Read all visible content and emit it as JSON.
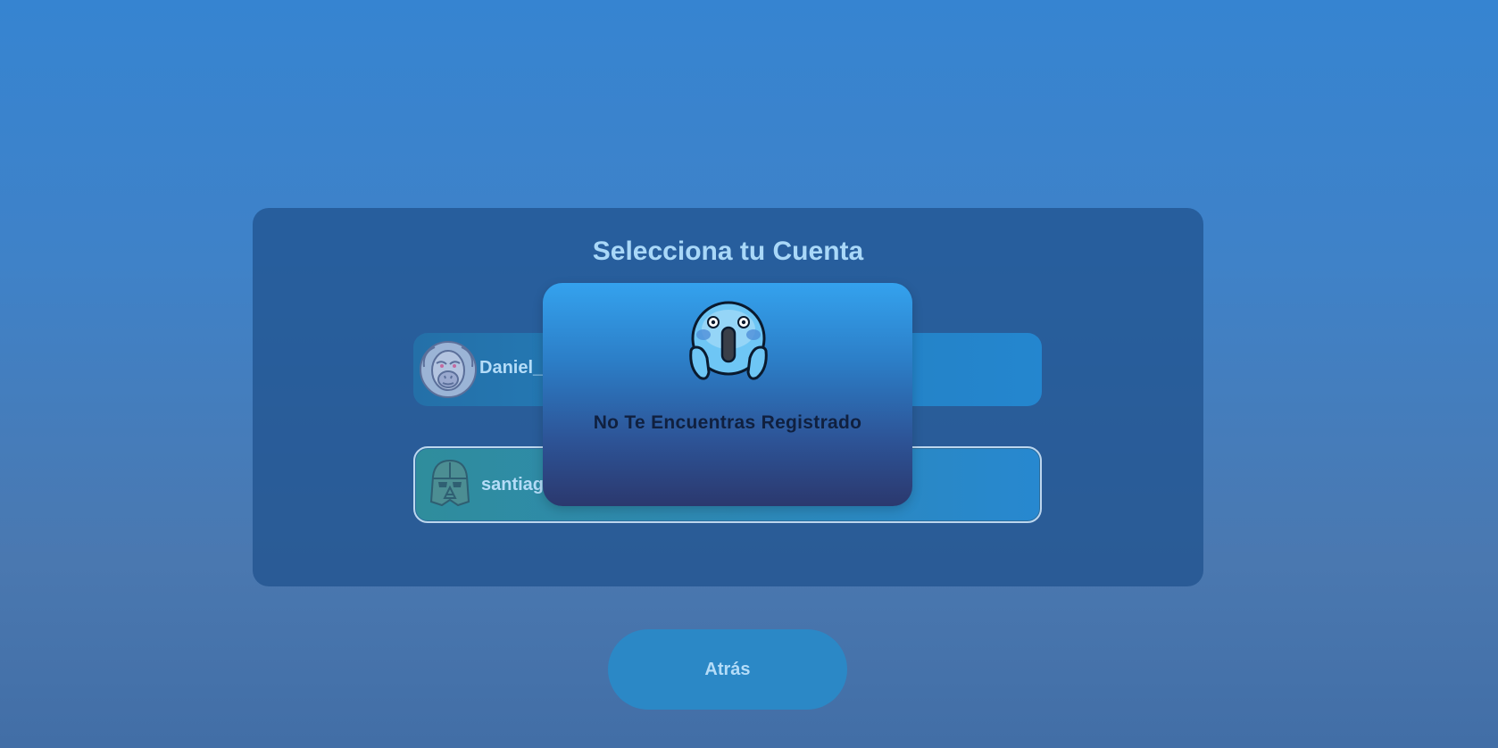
{
  "panel": {
    "title": "Selecciona tu Cuenta",
    "accounts": [
      {
        "username": "Daniel_",
        "avatar": "monkey-avatar-icon"
      },
      {
        "username": "santiago",
        "avatar": "darth-vader-avatar-icon"
      }
    ]
  },
  "back_button": {
    "label": "Atrás"
  },
  "modal": {
    "icon": "screaming-face-icon",
    "message": "No Te Encuentras Registrado"
  },
  "colors": {
    "title": "#a9d8f8",
    "modal_text": "#10203f",
    "button": "#2b88c6"
  }
}
